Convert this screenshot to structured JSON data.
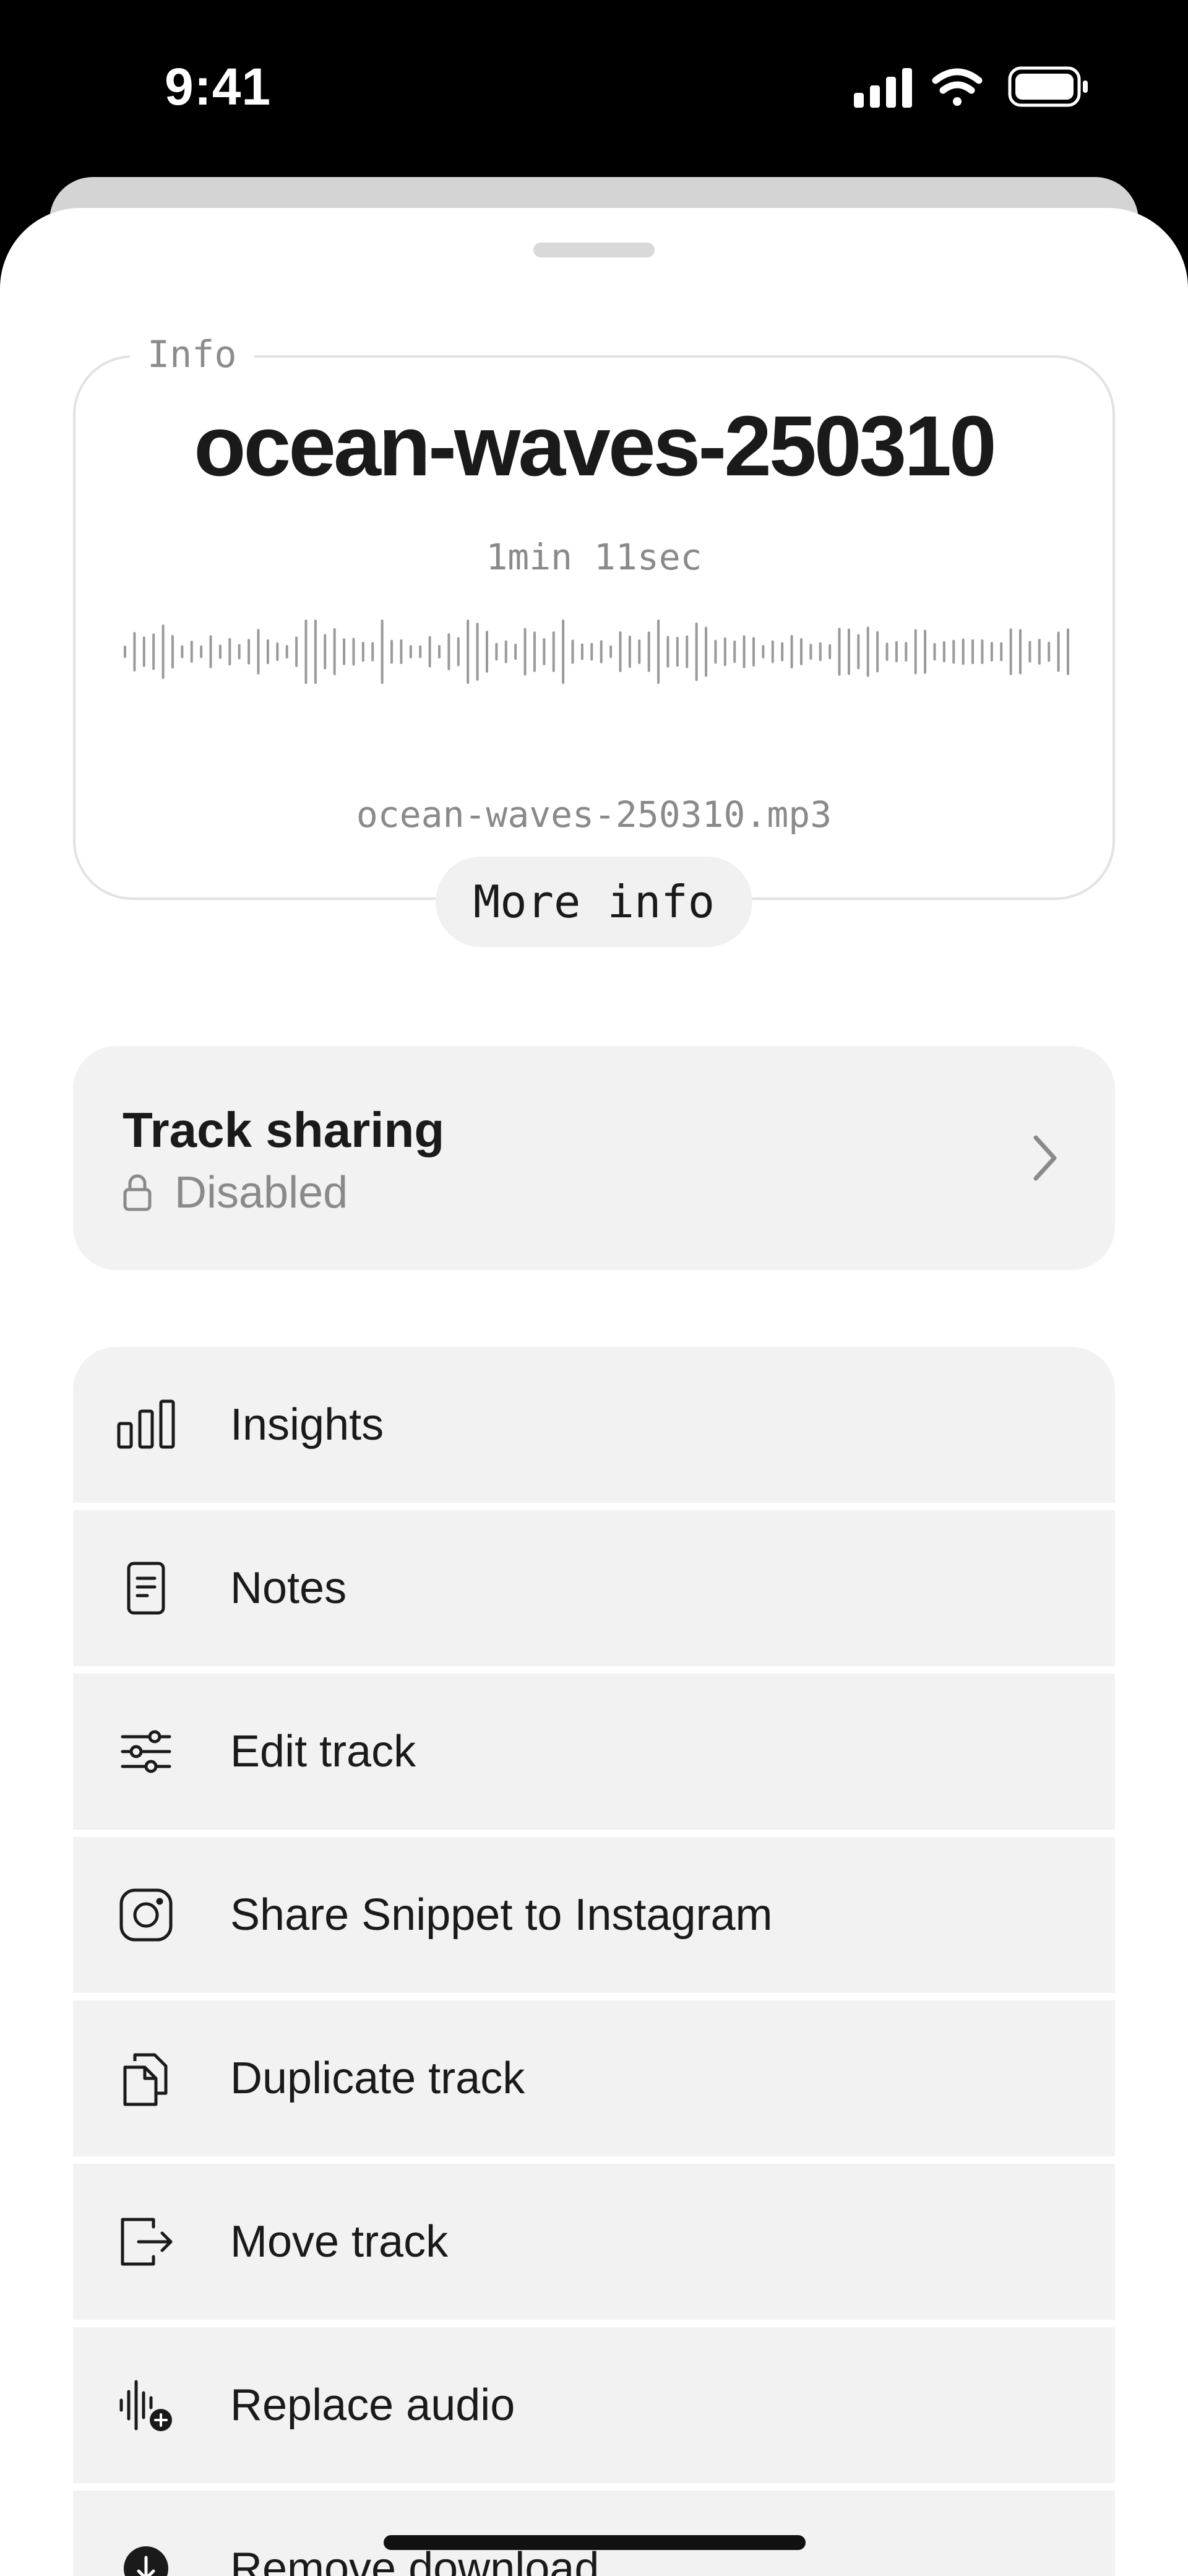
{
  "status_bar": {
    "time": "9:41",
    "icons": [
      "signal-icon",
      "wifi-icon",
      "battery-icon"
    ]
  },
  "info": {
    "label": "Info",
    "title": "ocean-waves-250310",
    "duration": "1min 11sec",
    "file_name": "ocean-waves-250310.mp3",
    "more_info_label": "More info"
  },
  "sharing": {
    "title": "Track sharing",
    "status": "Disabled",
    "status_icon": "lock-icon"
  },
  "actions": [
    {
      "label": "Insights",
      "icon": "bar-chart-icon"
    },
    {
      "label": "Notes",
      "icon": "note-icon"
    },
    {
      "label": "Edit track",
      "icon": "sliders-icon"
    },
    {
      "label": "Share Snippet to Instagram",
      "icon": "instagram-icon"
    },
    {
      "label": "Duplicate track",
      "icon": "duplicate-icon"
    },
    {
      "label": "Move track",
      "icon": "move-icon"
    },
    {
      "label": "Replace audio",
      "icon": "replace-audio-icon"
    },
    {
      "label": "Remove download",
      "icon": "download-icon"
    }
  ],
  "colors": {
    "text_primary": "#1a1a1a",
    "text_secondary": "#8a8a8a",
    "card_background": "#f2f2f2",
    "sheet_background": "#ffffff"
  }
}
